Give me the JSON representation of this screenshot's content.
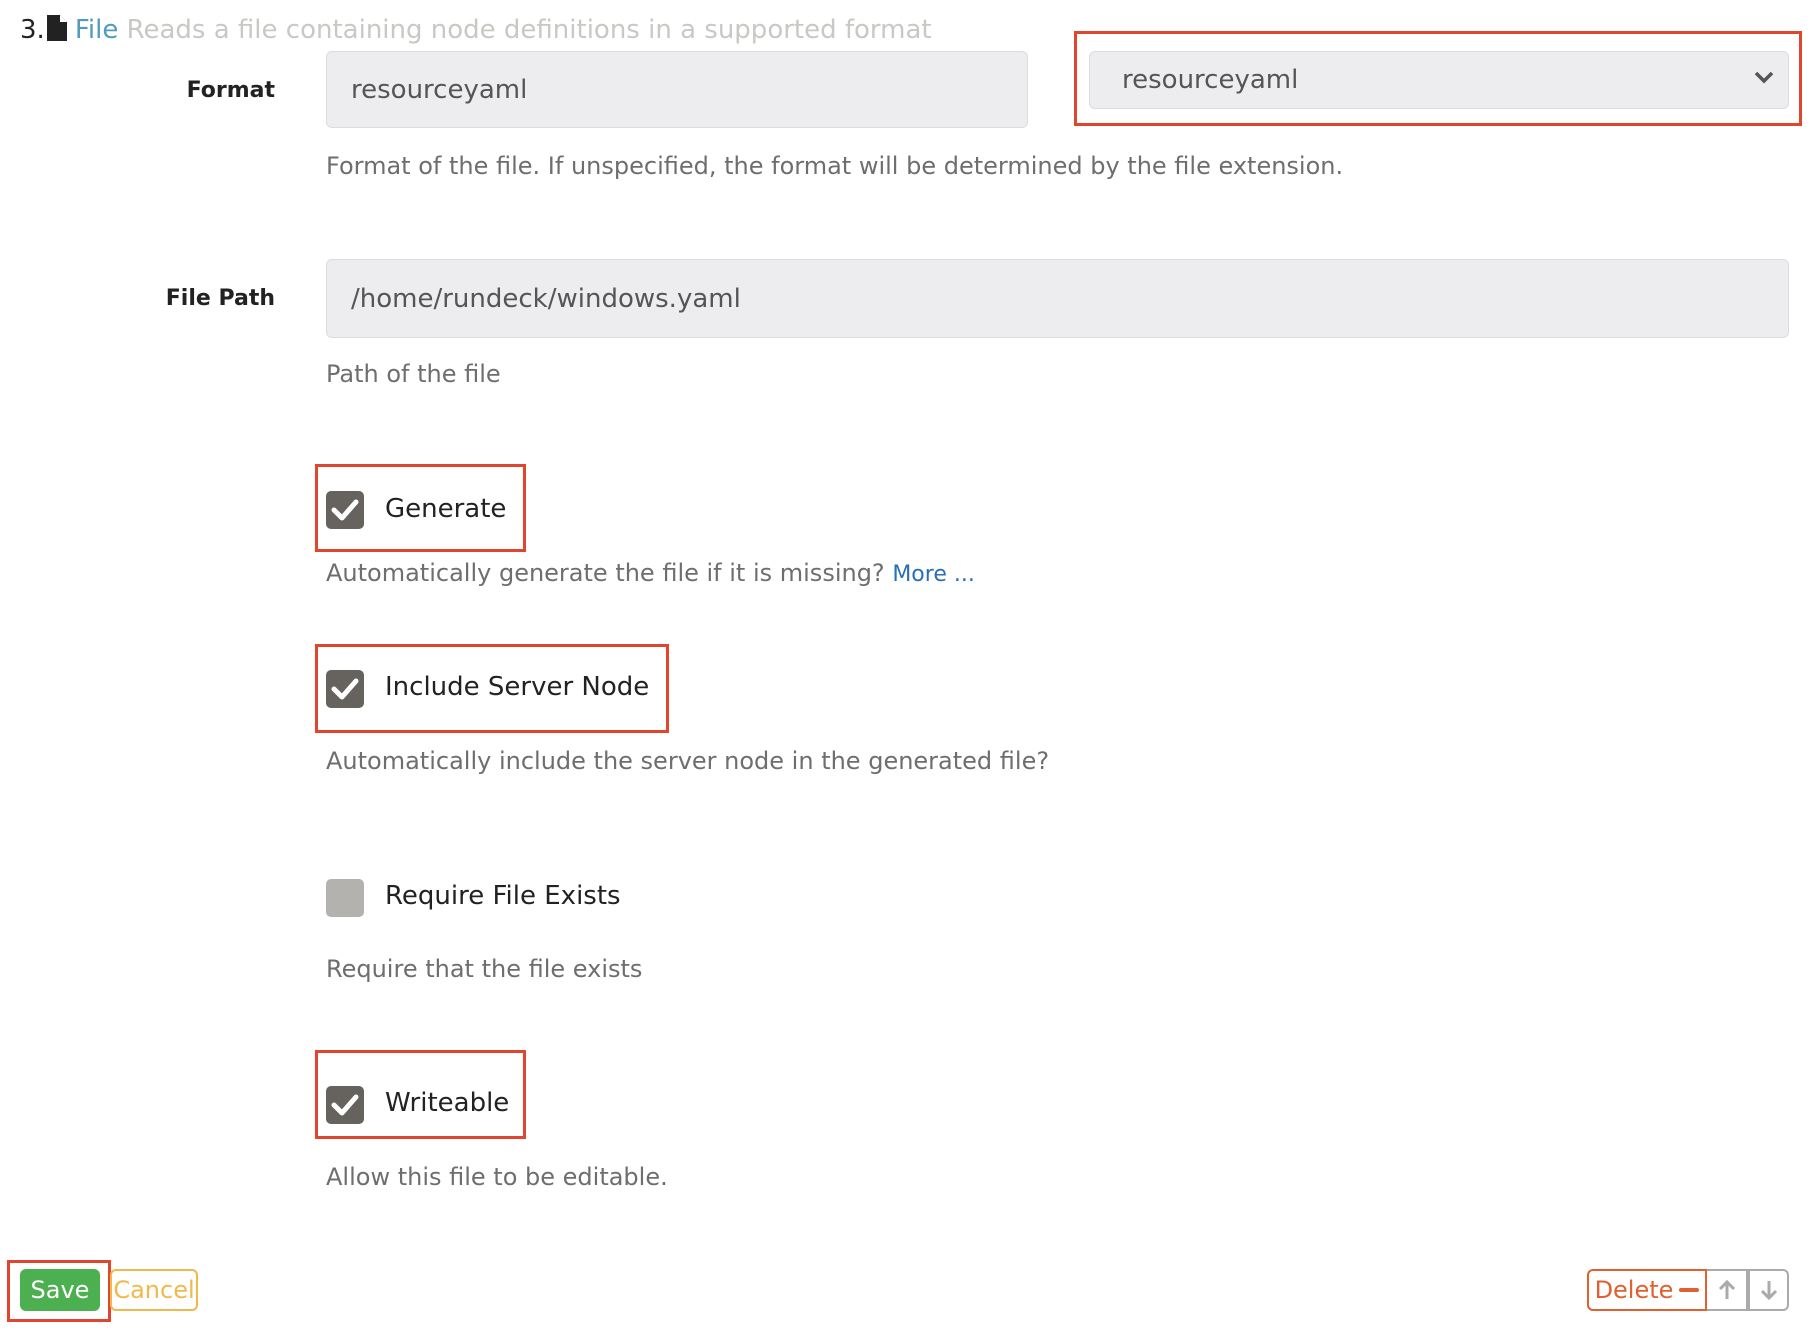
{
  "header": {
    "number": "3.",
    "icon": "file-icon",
    "name": "File",
    "description": "Reads a file containing node definitions in a supported format"
  },
  "format": {
    "label": "Format",
    "value": "resourceyaml",
    "select_value": "resourceyaml",
    "help": "Format of the file. If unspecified, the format will be determined by the file extension."
  },
  "file_path": {
    "label": "File Path",
    "value": "/home/rundeck/windows.yaml",
    "help": "Path of the file"
  },
  "options": [
    {
      "label": "Generate",
      "checked": true,
      "help": "Automatically generate the file if it is missing?",
      "more": "More ..."
    },
    {
      "label": "Include Server Node",
      "checked": true,
      "help": "Automatically include the server node in the generated file?"
    },
    {
      "label": "Require File Exists",
      "checked": false,
      "help": "Require that the file exists"
    },
    {
      "label": "Writeable",
      "checked": true,
      "help": "Allow this file to be editable."
    }
  ],
  "footer": {
    "save": "Save",
    "cancel": "Cancel",
    "delete": "Delete"
  },
  "colors": {
    "accent_blue": "#4f9dbb",
    "highlight_red": "#e0452e",
    "save_green": "#4caf50",
    "cancel_yellow": "#f0b94c",
    "delete_orange": "#e06030"
  }
}
